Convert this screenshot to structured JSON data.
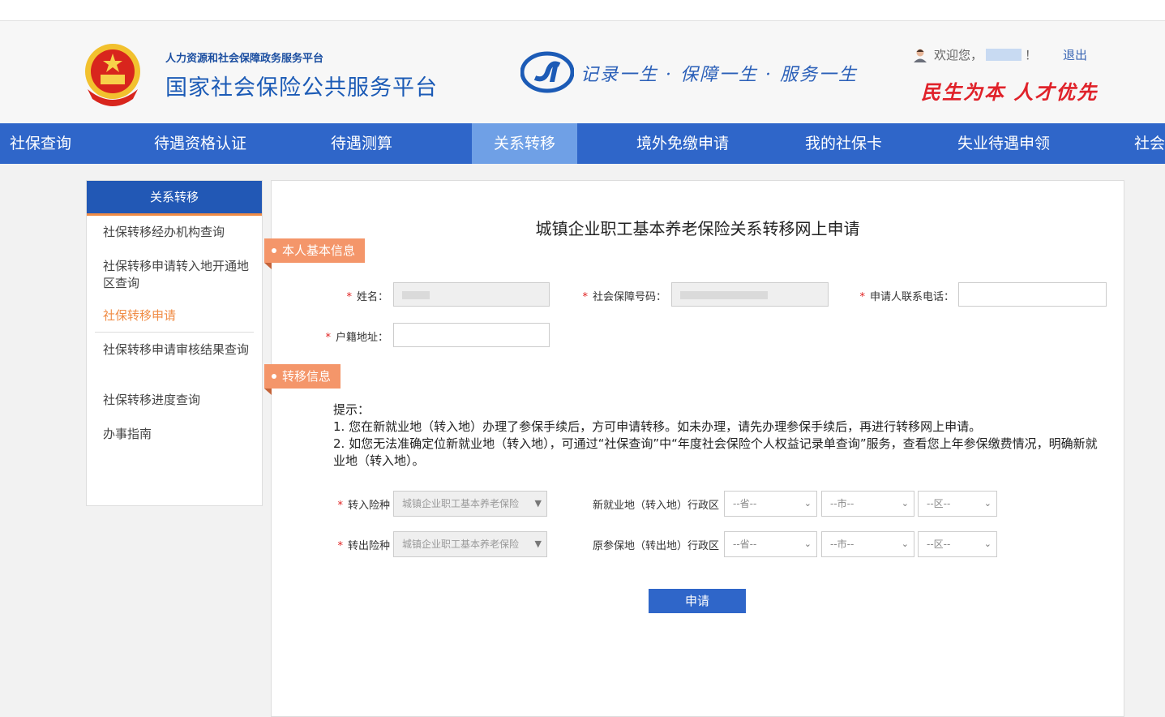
{
  "header": {
    "subtitle": "人力资源和社会保障政务服务平台",
    "title": "国家社会保险公共服务平台",
    "slogan": "记录一生 · 保障一生 · 服务一生",
    "welcome": "欢迎您，",
    "welcome_end": "！",
    "logout": "退出",
    "motto": "民生为本 人才优先"
  },
  "nav": {
    "items": [
      "社保查询",
      "待遇资格认证",
      "待遇测算",
      "关系转移",
      "境外免缴申请",
      "我的社保卡",
      "失业待遇申领",
      "社会"
    ]
  },
  "sidebar": {
    "header": "关系转移",
    "items": [
      "社保转移经办机构查询",
      "社保转移申请转入地开通地区查询",
      "社保转移申请",
      "社保转移申请审核结果查询",
      "社保转移进度查询",
      "办事指南"
    ]
  },
  "form": {
    "title": "城镇企业职工基本养老保险关系转移网上申请",
    "section1": "本人基本信息",
    "section2": "转移信息",
    "required_mark": "*",
    "name_label": "姓名：",
    "ssn_label": "社会保障号码：",
    "phone_label": "申请人联系电话：",
    "address_label": "户籍地址：",
    "tip_title": "提示：",
    "tip1": "1. 您在新就业地（转入地）办理了参保手续后，方可申请转移。如未办理，请先办理参保手续后，再进行转移网上申请。",
    "tip2": "2. 如您无法准确定位新就业地（转入地），可通过“社保查询”中“年度社会保险个人权益记录单查询”服务，查看您上年参保缴费情况，明确新就业地（转入地）。",
    "in_type_label": "转入险种",
    "out_type_label": "转出险种",
    "insurance_value": "城镇企业职工基本养老保险",
    "new_region_label": "新就业地（转入地）行政区",
    "old_region_label": "原参保地（转出地）行政区",
    "province_placeholder": "--省--",
    "city_placeholder": "--市--",
    "district_placeholder": "--区--",
    "submit": "申请"
  },
  "colors": {
    "nav_bg": "#2f66c9",
    "nav_active": "#6fa0e6",
    "accent_orange": "#f4966a",
    "required_red": "#e02020"
  }
}
